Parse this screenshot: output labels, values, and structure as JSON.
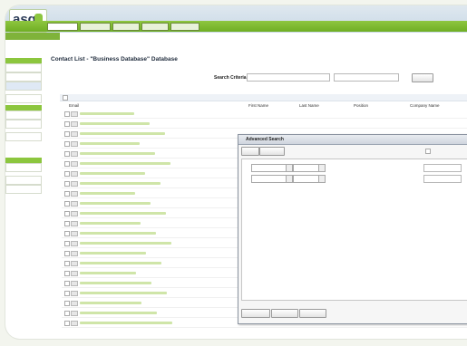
{
  "app": {
    "logo_text": "asg",
    "colors": {
      "accent": "#8cc63e",
      "accent_dark": "#6fae24",
      "navy": "#2b3b57",
      "link": "#8cc63e"
    }
  },
  "header": {
    "tabs": [
      "",
      "",
      "",
      "",
      ""
    ]
  },
  "sidebar": {
    "items": [
      "",
      "",
      "",
      "",
      "",
      "",
      "",
      "",
      "",
      ""
    ]
  },
  "page": {
    "title": "Contact List - \"Business Database\" Database",
    "search_label": "Search Criteria:",
    "search_value": "",
    "search_button": ""
  },
  "table": {
    "headers": [
      "Email",
      "First Name",
      "Last Name",
      "Position",
      "Company Name"
    ],
    "first_rows": [
      {
        "first": "",
        "company": ""
      },
      {
        "first": "",
        "company": ""
      },
      {
        "first": "",
        "company": ""
      }
    ],
    "bottom_rows": [
      {
        "first": "",
        "company": ""
      },
      {
        "first": "",
        "company": ""
      }
    ],
    "row_count": 22,
    "pager": ""
  },
  "dialog": {
    "title": "Advanced Search",
    "tabs": [
      "",
      ""
    ],
    "match_label": "",
    "criteria": [
      {
        "prefix": "",
        "field": "",
        "op": ""
      },
      {
        "prefix": "",
        "field": "",
        "op": ""
      }
    ],
    "buttons": [
      "",
      "",
      ""
    ]
  },
  "icons": [
    "envelope-icon",
    "checkbox-icon",
    "dropdown-arrow-icon",
    "close-icon"
  ]
}
